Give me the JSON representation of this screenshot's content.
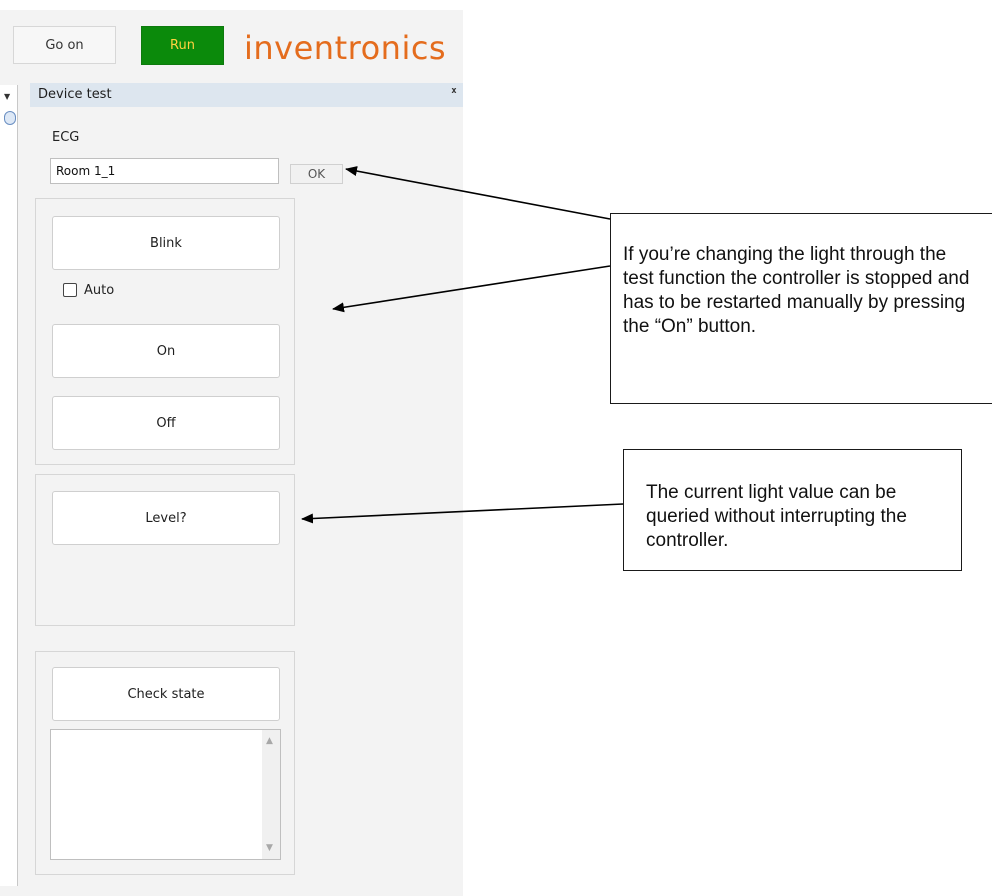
{
  "toolbar": {
    "go_on_label": "Go on",
    "run_label": "Run",
    "brand_logo_text": "inventronics",
    "run_button_color": "#0b8a0b",
    "brand_color": "#e46c1d"
  },
  "panel": {
    "title": "Device test",
    "pin_icon": "pin-icon"
  },
  "ecg": {
    "label": "ECG",
    "value": "Room 1_1",
    "ok_label": "OK"
  },
  "controls": {
    "blink_label": "Blink",
    "auto_label": "Auto",
    "auto_checked": false,
    "on_label": "On",
    "off_label": "Off"
  },
  "level": {
    "button_label": "Level?"
  },
  "state": {
    "button_label": "Check state",
    "output_text": ""
  },
  "callouts": [
    {
      "text": "If you’re changing the light through the test function the controller is stopped and has to be restarted manually by pressing the “On” button."
    },
    {
      "text": "The current light value can be queried without interrupting the controller."
    }
  ]
}
